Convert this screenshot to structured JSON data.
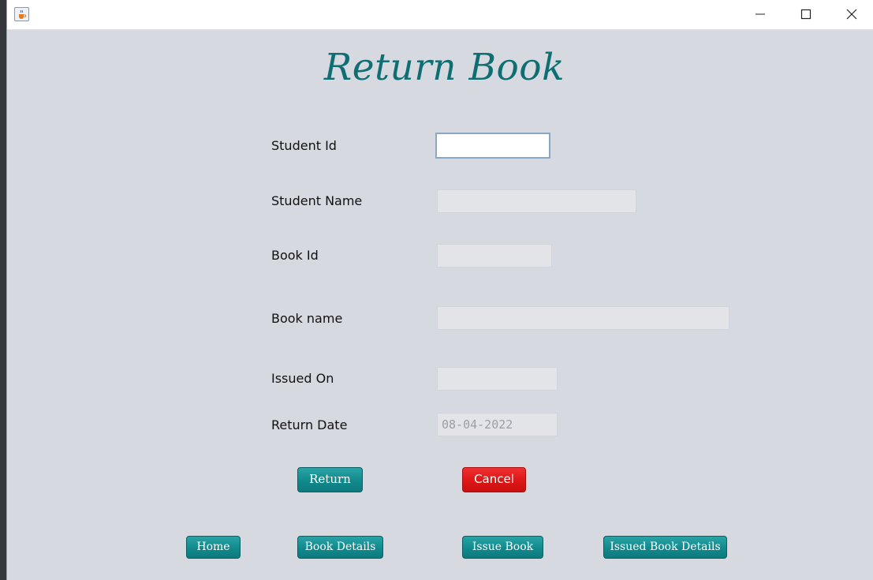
{
  "window": {
    "app_icon": "java-cup-icon",
    "controls": [
      "minimize-icon",
      "maximize-icon",
      "close-icon"
    ]
  },
  "page": {
    "title": "Return Book"
  },
  "form": {
    "student_id": {
      "label": "Student Id",
      "value": ""
    },
    "student_name": {
      "label": "Student Name",
      "value": ""
    },
    "book_id": {
      "label": "Book Id",
      "value": ""
    },
    "book_name": {
      "label": "Book name",
      "value": ""
    },
    "issued_on": {
      "label": "Issued On",
      "value": ""
    },
    "return_date": {
      "label": "Return Date",
      "value": "08-04-2022"
    }
  },
  "actions": {
    "return_label": "Return",
    "cancel_label": "Cancel"
  },
  "nav": {
    "home": "Home",
    "book_details": "Book Details",
    "issue_book": "Issue Book",
    "issued_book_details": "Issued Book Details"
  },
  "colors": {
    "title": "#0e6e72",
    "teal_button": "#118a8d",
    "red_button": "#dd1616",
    "background": "#d6d9e0"
  }
}
